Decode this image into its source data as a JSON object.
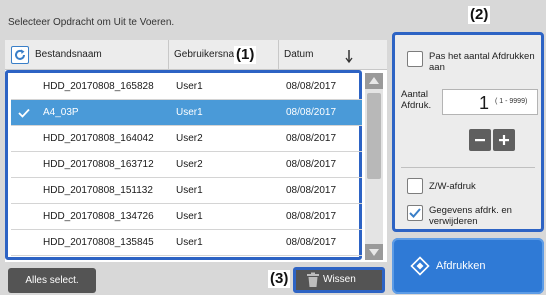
{
  "title": "Selecteer Opdracht om Uit te Voeren.",
  "table": {
    "columns": [
      "Bestandsnaam",
      "Gebruikersnaam",
      "Datum"
    ],
    "rows": [
      {
        "name": "HDD_20170808_165828",
        "user": "User1",
        "date": "08/08/2017",
        "selected": false
      },
      {
        "name": "A4_03P",
        "user": "User1",
        "date": "08/08/2017",
        "selected": true
      },
      {
        "name": "HDD_20170808_164042",
        "user": "User2",
        "date": "08/08/2017",
        "selected": false
      },
      {
        "name": "HDD_20170808_163712",
        "user": "User2",
        "date": "08/08/2017",
        "selected": false
      },
      {
        "name": "HDD_20170808_151132",
        "user": "User1",
        "date": "08/08/2017",
        "selected": false
      },
      {
        "name": "HDD_20170808_134726",
        "user": "User1",
        "date": "08/08/2017",
        "selected": false
      },
      {
        "name": "HDD_20170808_135845",
        "user": "User1",
        "date": "08/08/2017",
        "selected": false
      }
    ]
  },
  "settings": {
    "set_copies_label": "Pas het aantal Afdrukken aan",
    "copies_label": "Aantal Afdruk.",
    "copies_value": "1",
    "copies_range": "( 1 - 9999)",
    "bw_print_label": "Z/W-afdruk",
    "delete_after_print_label": "Gegevens afdrk. en verwijderen",
    "set_copies_checked": false,
    "bw_print_checked": false,
    "delete_after_print_checked": true
  },
  "buttons": {
    "select_all": "Alles select.",
    "delete": "Wissen",
    "print": "Afdrukken"
  },
  "callouts": {
    "one": "(1)",
    "two": "(2)",
    "three": "(3)"
  },
  "colors": {
    "accent": "#2d63c4",
    "selected_row": "#4a9ad8",
    "print_button": "#2f7ad6",
    "dark_button": "#545454"
  },
  "icons": {
    "refresh": "refresh-icon",
    "sort": "sort-arrow-icon",
    "check": "checkmark-icon",
    "trash": "trash-icon",
    "print": "diamond-print-icon"
  }
}
